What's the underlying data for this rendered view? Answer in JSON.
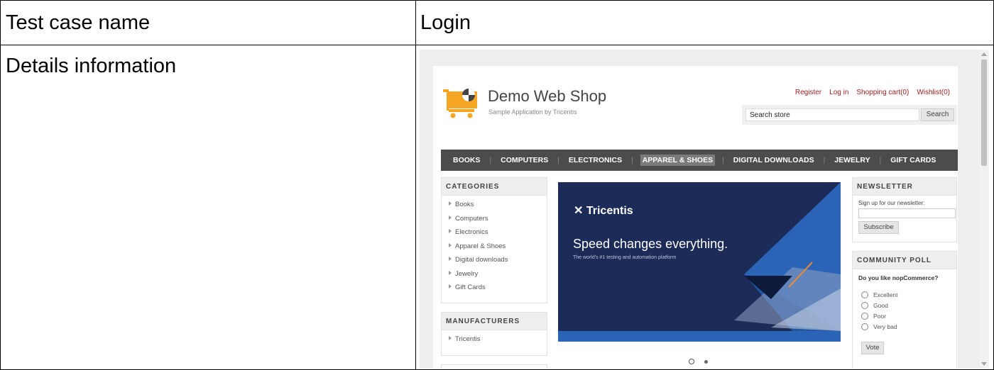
{
  "table": {
    "row1": {
      "label": "Test case name",
      "value": "Login"
    },
    "row2": {
      "label": "Details information"
    }
  },
  "shop": {
    "brand_title": "Demo Web Shop",
    "brand_subtitle": "Sample Application by Tricentis",
    "top_links": [
      "Register",
      "Log in",
      "Shopping cart(0)",
      "Wishlist(0)"
    ],
    "search": {
      "value": "Search store",
      "button": "Search"
    },
    "nav": [
      "BOOKS",
      "COMPUTERS",
      "ELECTRONICS",
      "APPAREL & SHOES",
      "DIGITAL DOWNLOADS",
      "JEWELRY",
      "GIFT CARDS"
    ],
    "nav_active": "APPAREL & SHOES",
    "categories": {
      "title": "CATEGORIES",
      "items": [
        "Books",
        "Computers",
        "Electronics",
        "Apparel & Shoes",
        "Digital downloads",
        "Jewelry",
        "Gift Cards"
      ]
    },
    "manufacturers": {
      "title": "MANUFACTURERS",
      "items": [
        "Tricentis"
      ]
    },
    "banner": {
      "logo": "✕ Tricentis",
      "headline": "Speed changes everything.",
      "tagline": "The world's #1 testing and automation platform"
    },
    "newsletter": {
      "title": "NEWSLETTER",
      "prompt": "Sign up for our newsletter:",
      "button": "Subscribe"
    },
    "poll": {
      "title": "COMMUNITY POLL",
      "question": "Do you like nopCommerce?",
      "options": [
        "Excellent",
        "Good",
        "Poor",
        "Very bad"
      ],
      "button": "Vote"
    }
  },
  "colors": {
    "nav_bg": "#4c4c4c",
    "banner_bg": "#1c2b58",
    "link_red": "#a02020",
    "cart_orange": "#f5a623"
  }
}
